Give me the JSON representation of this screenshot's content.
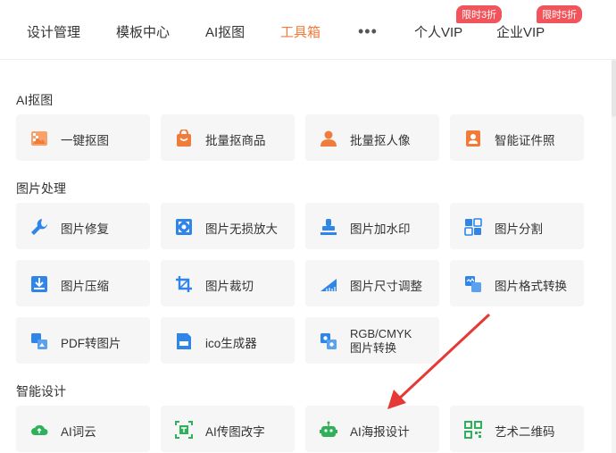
{
  "nav": {
    "items": [
      "设计管理",
      "模板中心",
      "AI抠图",
      "工具箱"
    ],
    "more": "•••",
    "vip_personal": "个人VIP",
    "vip_enterprise": "企业VIP",
    "badge_personal": "限时3折",
    "badge_enterprise": "限时5折"
  },
  "sections": {
    "ai_cutout": {
      "title": "AI抠图",
      "tools": [
        "一键抠图",
        "批量抠商品",
        "批量抠人像",
        "智能证件照"
      ]
    },
    "image_processing": {
      "title": "图片处理",
      "tools": [
        "图片修复",
        "图片无损放大",
        "图片加水印",
        "图片分割",
        "图片压缩",
        "图片裁切",
        "图片尺寸调整",
        "图片格式转换",
        "PDF转图片",
        "ico生成器"
      ],
      "rgb_line1": "RGB/CMYK",
      "rgb_line2": "图片转换"
    },
    "smart_design": {
      "title": "智能设计",
      "tools": [
        "AI词云",
        "AI传图改字",
        "AI海报设计",
        "艺术二维码"
      ]
    }
  },
  "colors": {
    "accent": "#f07b3a",
    "badge": "#f2545b",
    "arrow": "#e53935",
    "icon_blue": "#2f86e8",
    "icon_orange": "#f07b3a",
    "icon_green": "#2fb15b"
  }
}
